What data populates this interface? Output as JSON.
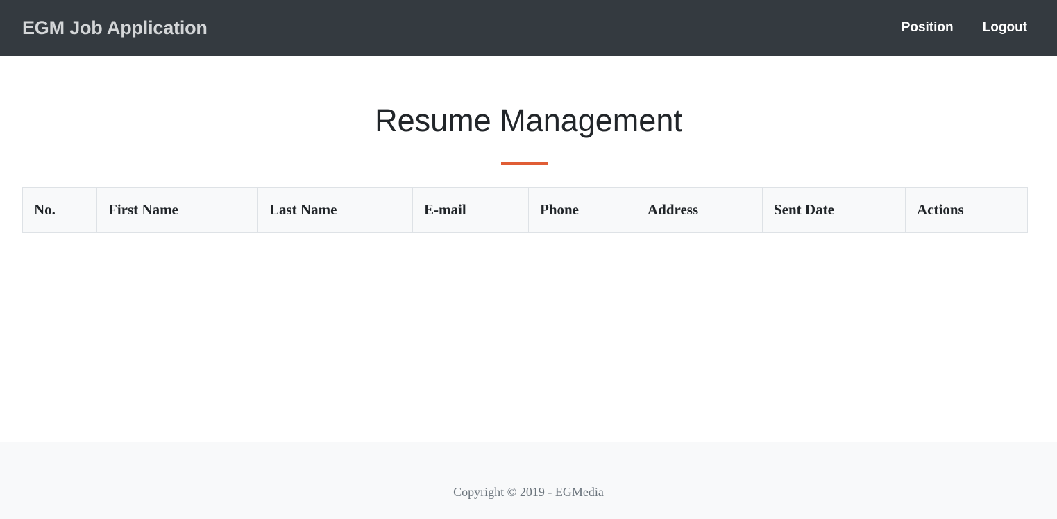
{
  "navbar": {
    "brand": "EGM Job Application",
    "links": [
      "Position",
      "Logout"
    ]
  },
  "main": {
    "title": "Resume Management",
    "table": {
      "columns": [
        "No.",
        "First Name",
        "Last Name",
        "E-mail",
        "Phone",
        "Address",
        "Sent Date",
        "Actions"
      ],
      "rows": []
    }
  },
  "footer": {
    "copyright": "Copyright © 2019 - EGMedia"
  },
  "colors": {
    "navbar_bg": "#343a40",
    "accent": "#e05d35",
    "footer_bg": "#f8f9fa"
  }
}
